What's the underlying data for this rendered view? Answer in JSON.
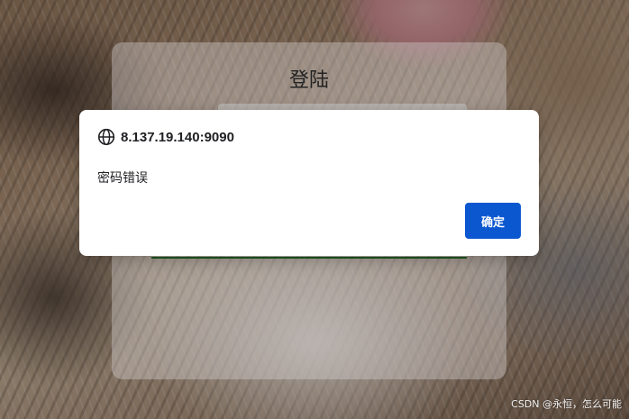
{
  "login": {
    "title": "登陆"
  },
  "dialog": {
    "origin": "8.137.19.140:9090",
    "message": "密码错误",
    "ok_label": "确定",
    "icon": "globe-icon",
    "accent_color": "#0b57d0"
  },
  "watermark": {
    "text": "CSDN @永恒，怎么可能"
  }
}
